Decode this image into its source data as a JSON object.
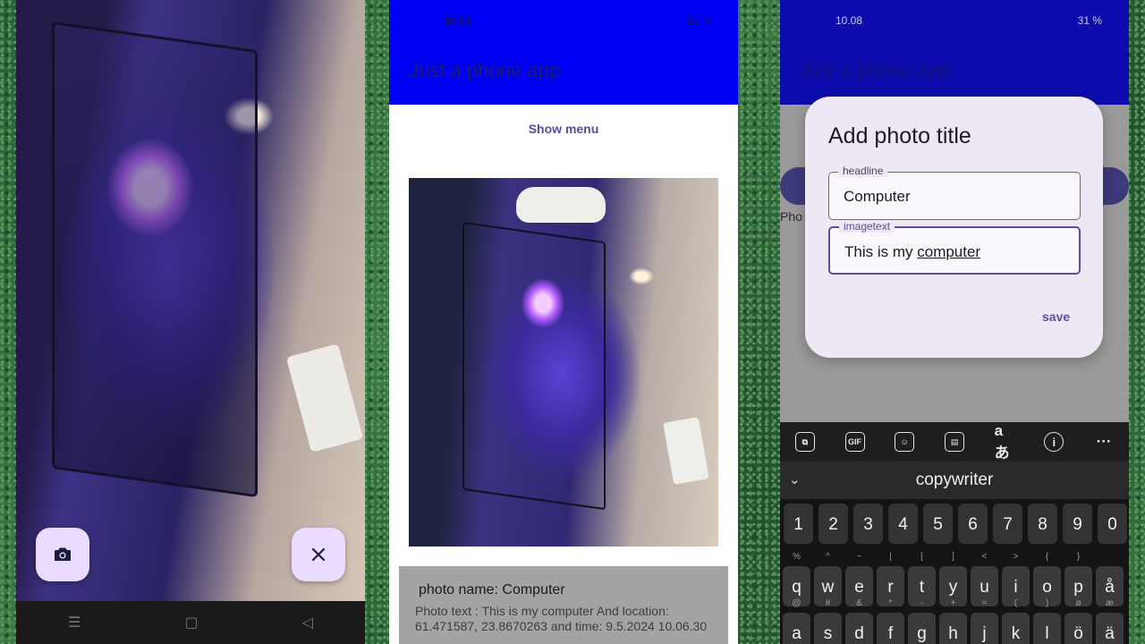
{
  "status_bar": {
    "time": "10.08",
    "right": "31 %"
  },
  "camera": {
    "capture_icon": "camera-icon",
    "close_icon": "close-icon",
    "nav": [
      "☰",
      "▢",
      "◁"
    ]
  },
  "app": {
    "title": "Just a phone app",
    "show_menu": "Show menu",
    "photo": {
      "name_line": "photo name: Computer",
      "text_line": "Photo text : This is my computer And location: 61.471587, 23.8670263 and time: 9.5.2024 10.06.30"
    }
  },
  "dialog": {
    "title": "Add photo title",
    "headline_label": "headline",
    "headline_value": "Computer",
    "imagetext_label": "imagetext",
    "imagetext_prefix": "This is my ",
    "imagetext_underlined": "computer",
    "save": "save",
    "background_text": "Pho"
  },
  "keyboard": {
    "toolbar_icons": [
      "copilot-icon",
      "gif-icon",
      "sticker-icon",
      "clipboard-icon",
      "translate-icon",
      "info-icon",
      "more-icon"
    ],
    "toolbar_glyphs": [
      "⧉",
      "GIF",
      "☺",
      "▤",
      "aあ",
      "i",
      "···"
    ],
    "suggestion": "copywriter",
    "collapse": "⌄",
    "number_row": [
      "1",
      "2",
      "3",
      "4",
      "5",
      "6",
      "7",
      "8",
      "9",
      "0"
    ],
    "row1": [
      {
        "k": "q",
        "h": "%"
      },
      {
        "k": "w",
        "h": "^"
      },
      {
        "k": "e",
        "h": "~"
      },
      {
        "k": "r",
        "h": "|"
      },
      {
        "k": "t",
        "h": "["
      },
      {
        "k": "y",
        "h": "]"
      },
      {
        "k": "u",
        "h": "<"
      },
      {
        "k": "i",
        "h": ">"
      },
      {
        "k": "o",
        "h": "{"
      },
      {
        "k": "p",
        "h": "}"
      },
      {
        "k": "å",
        "h": ""
      }
    ],
    "row2": [
      {
        "k": "a",
        "h": "@"
      },
      {
        "k": "s",
        "h": "#"
      },
      {
        "k": "d",
        "h": "&"
      },
      {
        "k": "f",
        "h": "*"
      },
      {
        "k": "g",
        "h": "-"
      },
      {
        "k": "h",
        "h": "+"
      },
      {
        "k": "j",
        "h": "="
      },
      {
        "k": "k",
        "h": "("
      },
      {
        "k": "l",
        "h": ")"
      },
      {
        "k": "ö",
        "h": "ø"
      },
      {
        "k": "ä",
        "h": "æ"
      }
    ]
  },
  "colors": {
    "appbar": "#0000f5",
    "accent": "#5f4b9e",
    "fab_bg": "#eadcff"
  }
}
